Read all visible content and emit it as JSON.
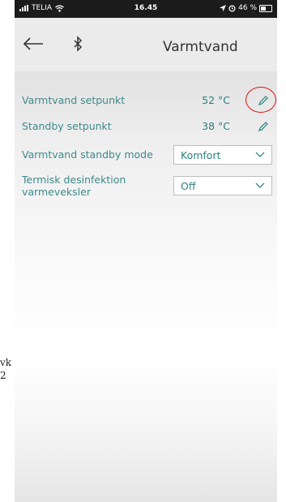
{
  "status": {
    "carrier": "TELIA",
    "time": "16.45",
    "battery": "46 %"
  },
  "nav": {
    "title": "Varmtvand",
    "back_icon": "arrow-left-icon",
    "bluetooth_icon": "bluetooth-icon"
  },
  "settings": {
    "hot_water_setpoint": {
      "label": "Varmtvand setpunkt",
      "value": "52 °C"
    },
    "standby_setpoint": {
      "label": "Standby setpunkt",
      "value": "38 °C"
    },
    "standby_mode": {
      "label": "Varmtvand standby mode",
      "selected": "Komfort"
    },
    "disinfection": {
      "label_line1": "Termisk desinfektion",
      "label_line2": "varmeveksler",
      "selected": "Off"
    }
  },
  "side_text": {
    "line1": "vk",
    "line2": "2"
  },
  "colors": {
    "accent": "#3e8a8a",
    "highlight_circle": "#dd1111"
  }
}
